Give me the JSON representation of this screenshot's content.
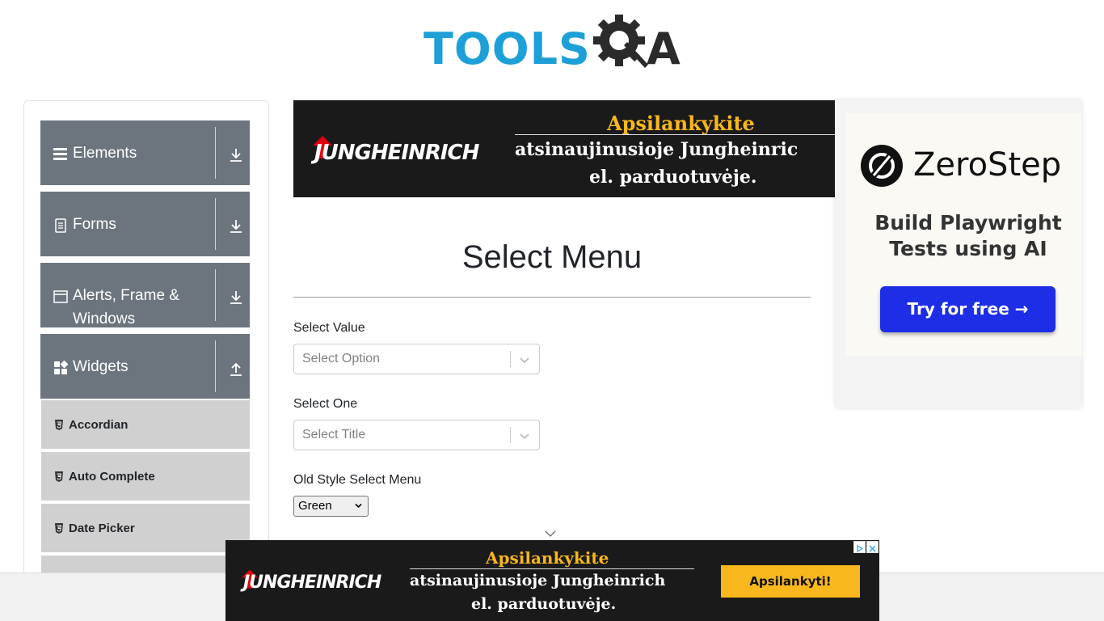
{
  "logo": {
    "tools_text": "TOOLS",
    "a_text": "A"
  },
  "sidebar": {
    "groups": [
      {
        "label": "Elements",
        "icon": "hamburger-icon",
        "arrow": "download-arrow-icon"
      },
      {
        "label": "Forms",
        "icon": "document-icon",
        "arrow": "download-arrow-icon"
      },
      {
        "label": "Alerts, Frame &",
        "label2": "Windows",
        "icon": "window-icon",
        "arrow": "download-arrow-icon"
      },
      {
        "label": "Widgets",
        "icon": "widgets-icon",
        "arrow": "upload-arrow-icon"
      }
    ],
    "widget_items": [
      {
        "label": "Accordian",
        "icon": "html5-icon"
      },
      {
        "label": "Auto Complete",
        "icon": "html5-icon"
      },
      {
        "label": "Date Picker",
        "icon": "html5-icon"
      }
    ]
  },
  "top_ad": {
    "brand": "JUNGHEINRICH",
    "headline": "Apsilankykite",
    "line2": "atsinaujinusioje Jungheinric",
    "line3": "el. parduotuvėje."
  },
  "main": {
    "title": "Select Menu",
    "select_value": {
      "label": "Select Value",
      "placeholder": "Select Option"
    },
    "select_one": {
      "label": "Select One",
      "placeholder": "Select Title"
    },
    "old_style": {
      "label": "Old Style Select Menu",
      "selected": "Green"
    }
  },
  "side_ad": {
    "brand": "ZeroStep",
    "tagline1": "Build Playwright",
    "tagline2": "Tests using AI",
    "button": "Try for free →"
  },
  "bottom_ad": {
    "brand": "JUNGHEINRICH",
    "headline": "Apsilankykite",
    "line2": "atsinaujinusioje Jungheinrich",
    "line3": "el. parduotuvėje.",
    "cta": "Apsilankyti!"
  },
  "colors": {
    "accent_blue": "#1da0d8",
    "sidebar_group": "#6c757d",
    "sidebar_item": "#d0d0d0",
    "ad_yellow": "#f8b71c",
    "zs_button": "#1d2ee6"
  }
}
